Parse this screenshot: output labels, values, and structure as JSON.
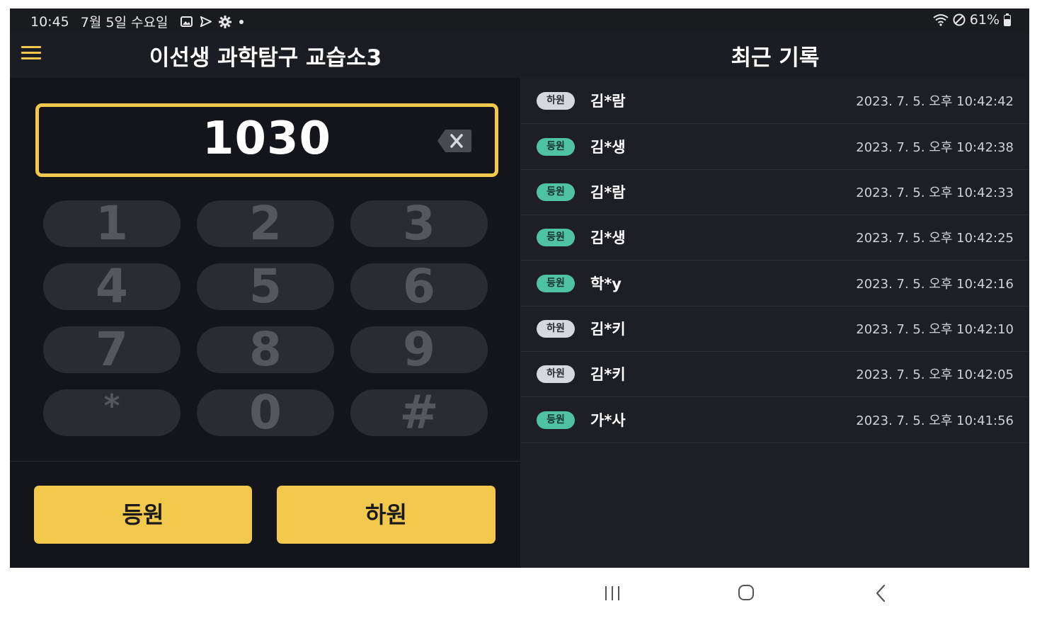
{
  "status_bar": {
    "time": "10:45",
    "date": "7월 5일 수요일",
    "battery": "61%",
    "icons": [
      "image-icon",
      "send-icon",
      "gear-icon",
      "dot-icon",
      "wifi-icon",
      "do-not-disturb-icon",
      "battery-icon"
    ]
  },
  "header": {
    "title": "이선생 과학탐구 교습소3",
    "recent_title": "최근 기록"
  },
  "display": {
    "value": "1030"
  },
  "keypad": {
    "keys": [
      "1",
      "2",
      "3",
      "4",
      "5",
      "6",
      "7",
      "8",
      "9",
      "*",
      "0",
      "#"
    ]
  },
  "actions": {
    "checkin_label": "등원",
    "checkout_label": "하원"
  },
  "records": [
    {
      "type": "하원",
      "name": "김*람",
      "time": "2023. 7. 5. 오후 10:42:42"
    },
    {
      "type": "등원",
      "name": "김*생",
      "time": "2023. 7. 5. 오후 10:42:38"
    },
    {
      "type": "등원",
      "name": "김*람",
      "time": "2023. 7. 5. 오후 10:42:33"
    },
    {
      "type": "등원",
      "name": "김*생",
      "time": "2023. 7. 5. 오후 10:42:25"
    },
    {
      "type": "등원",
      "name": "학*y",
      "time": "2023. 7. 5. 오후 10:42:16"
    },
    {
      "type": "하원",
      "name": "김*키",
      "time": "2023. 7. 5. 오후 10:42:10"
    },
    {
      "type": "하원",
      "name": "김*키",
      "time": "2023. 7. 5. 오후 10:42:05"
    },
    {
      "type": "등원",
      "name": "가*사",
      "time": "2023. 7. 5. 오후 10:41:56"
    }
  ],
  "colors": {
    "accent": "#f2c94c",
    "checkin_badge": "#4fc2a4",
    "checkout_badge": "#d6d8de",
    "background": "#1c1d22"
  }
}
